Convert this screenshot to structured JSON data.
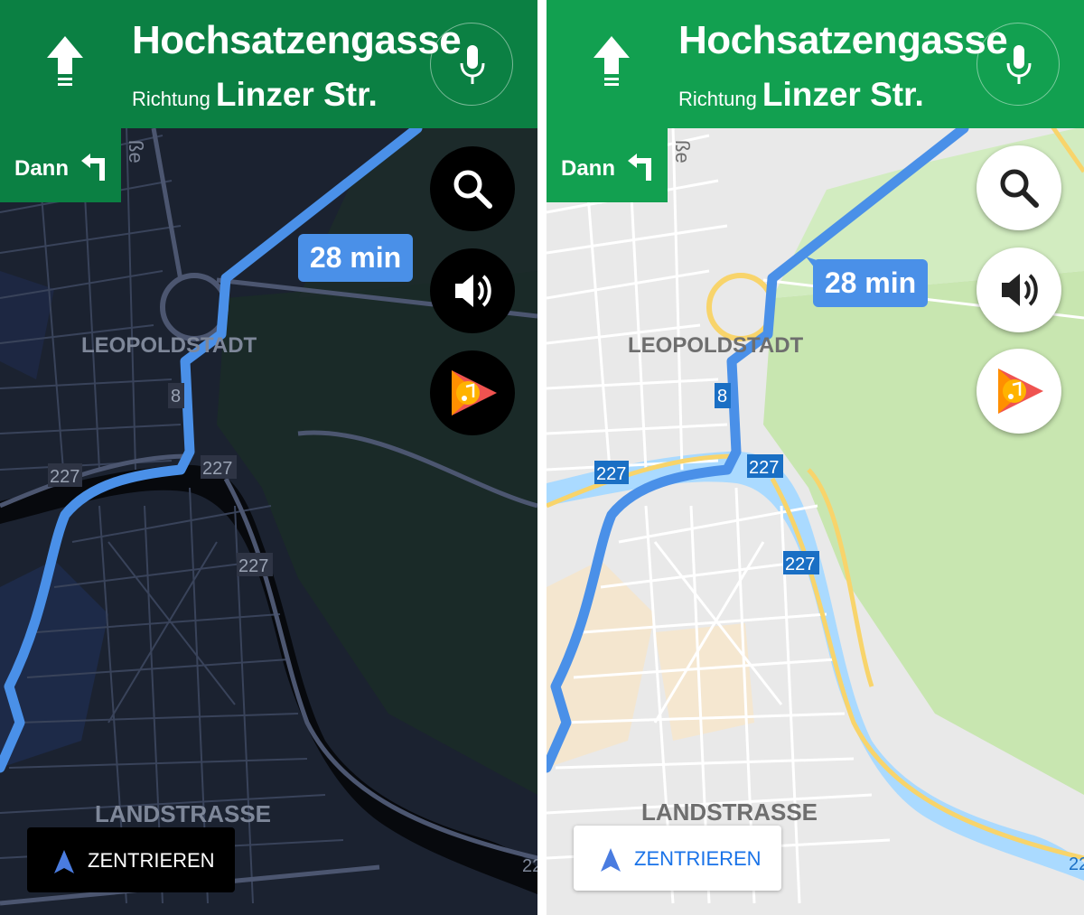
{
  "navigation": {
    "street_name": "Hochsatzengasse",
    "direction_word": "Richtung",
    "direction_target": "Linzer Str.",
    "then_label": "Dann",
    "eta": "28 min",
    "recenter_label": "ZENTRIEREN"
  },
  "map": {
    "districts": [
      "LEOPOLDSTADT",
      "LANDSTRASSE"
    ],
    "road_shields": [
      "227",
      "227",
      "227",
      "8"
    ],
    "partial_street_text": "ße",
    "edge_text": "22"
  },
  "icons": {
    "straight": "arrow-up-icon",
    "turn": "turn-left-icon",
    "mic": "microphone-icon",
    "search": "search-icon",
    "sound": "speaker-icon",
    "music": "play-music-icon",
    "recenter": "navigation-arrow-icon"
  },
  "themes": {
    "dark": {
      "header": "#0b8043",
      "map_bg": "#1b2230",
      "route": "#4a90e8",
      "fab": "#000000"
    },
    "light": {
      "header": "#12a050",
      "map_bg": "#e9e9e9",
      "route": "#4a90e8",
      "fab": "#ffffff"
    }
  }
}
